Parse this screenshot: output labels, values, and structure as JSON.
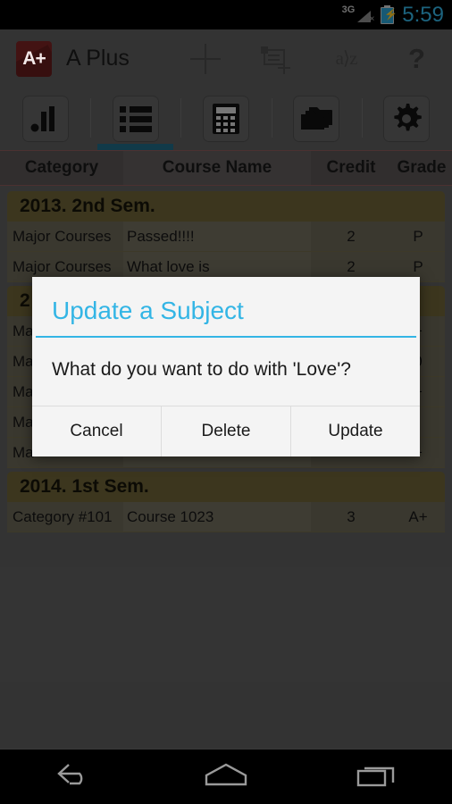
{
  "status_bar": {
    "network_label": "3G",
    "signal_icon": "signal-triangle-icon",
    "no_service_mark": "×",
    "battery_icon": "battery-charging-icon",
    "battery_bolt": "⚡",
    "time": "5:59",
    "time_color": "#33b5e5"
  },
  "action_bar": {
    "app_icon_text": "A+",
    "app_icon_color": "#7a2424",
    "title": "A Plus",
    "actions": [
      {
        "name": "add-button",
        "icon": "plus-icon"
      },
      {
        "name": "add-note-button",
        "icon": "add-note-icon"
      },
      {
        "name": "sort-button",
        "icon": "a-to-z-sort-icon",
        "label": "a⟩z"
      },
      {
        "name": "help-button",
        "icon": "question-mark-icon",
        "label": "?"
      }
    ]
  },
  "tabs": {
    "active_index": 1,
    "indicator_color": "#1f6b85",
    "items": [
      {
        "name": "tab-statistics",
        "icon": "bar-chart-icon"
      },
      {
        "name": "tab-list",
        "icon": "list-icon"
      },
      {
        "name": "tab-calculator",
        "icon": "calculator-icon"
      },
      {
        "name": "tab-folders",
        "icon": "folders-icon"
      },
      {
        "name": "tab-settings",
        "icon": "gear-icon"
      }
    ]
  },
  "table": {
    "columns": [
      "Category",
      "Course Name",
      "Credit",
      "Grade"
    ],
    "sections": [
      {
        "header": "2013. 2nd Sem.",
        "rows": [
          {
            "category": "Major Courses",
            "course": "Passed!!!!",
            "credit": "2",
            "grade": "P"
          },
          {
            "category": "Major Courses",
            "course": "What love is",
            "credit": "2",
            "grade": "P"
          }
        ]
      },
      {
        "header": "2",
        "rows": [
          {
            "category": "Ma",
            "course": "",
            "credit": "",
            "grade": "+"
          },
          {
            "category": "Ma",
            "course": "",
            "credit": "",
            "grade": "0"
          },
          {
            "category": "Ma",
            "course": "",
            "credit": "",
            "grade": "+"
          },
          {
            "category": "Ma",
            "course": "",
            "credit": "",
            "grade": ":"
          },
          {
            "category": "Ma",
            "course": "",
            "credit": "",
            "grade": "+"
          }
        ]
      },
      {
        "header": "2014. 1st Sem.",
        "rows": [
          {
            "category": "Category #101",
            "course": "Course 1023",
            "credit": "3",
            "grade": "A+"
          }
        ]
      }
    ]
  },
  "dialog": {
    "title": "Update a Subject",
    "title_color": "#33b5e5",
    "message": "What do you want to do with 'Love'?",
    "buttons": [
      {
        "name": "cancel-button",
        "label": "Cancel"
      },
      {
        "name": "delete-button",
        "label": "Delete"
      },
      {
        "name": "update-button",
        "label": "Update"
      }
    ]
  },
  "nav_bar": {
    "back_icon": "back-arrow-icon",
    "home_icon": "home-icon",
    "recents_icon": "recent-apps-icon"
  }
}
